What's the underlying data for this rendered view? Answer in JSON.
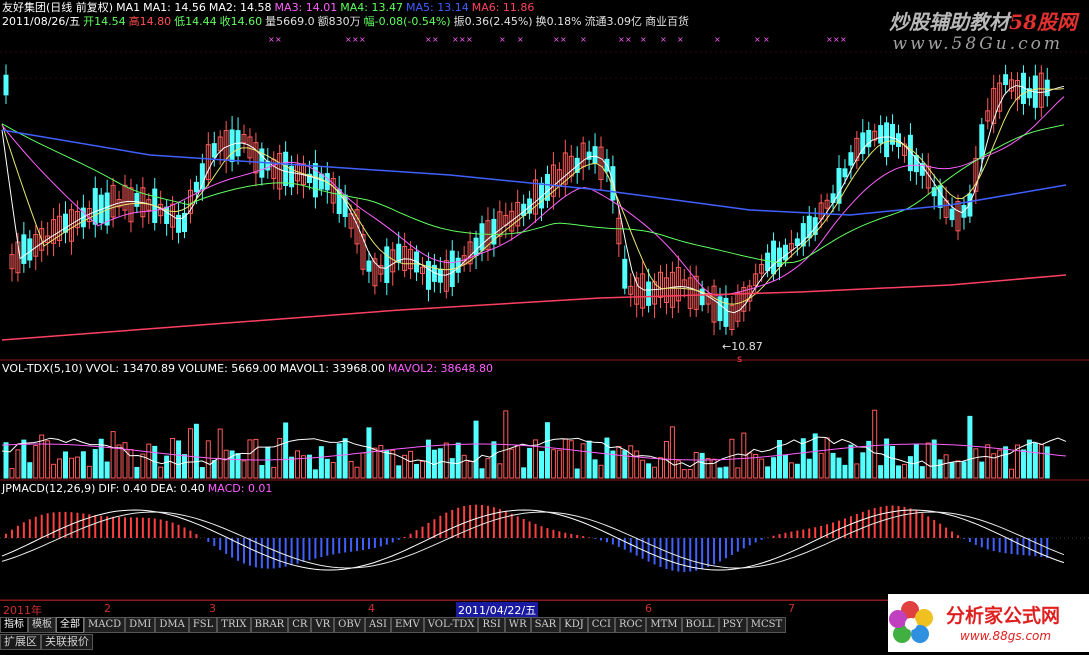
{
  "header": {
    "stock_name": "友好集团(日线 前复权)",
    "ma1_label": "MA1",
    "ma1": "MA1: 14.56",
    "ma2": "MA2: 14.58",
    "ma3": "MA3: 14.01",
    "ma4": "MA4: 13.47",
    "ma5": "MA5: 13.14",
    "ma6": "MA6: 11.86",
    "date": "2011/08/26/五",
    "open": "开14.54",
    "high": "高14.80",
    "low": "低14.44",
    "close": "收14.60",
    "volume": "量5669.0",
    "amount": "额830万",
    "change": "幅-0.08(-0.54%)",
    "amplitude": "振0.36(2.45%)",
    "turnover": "换0.18%",
    "float_cap": "流通3.09亿",
    "sector": "商业百货"
  },
  "watermark": {
    "text_main": "炒股辅助教材",
    "text_red": "58股网",
    "url": "www.58Gu.com"
  },
  "price_annotation": "←10.87",
  "vol_header": {
    "indicator": "VOL-TDX(5,10)",
    "vvol": "VVOL: 13470.89",
    "volume": "VOLUME: 5669.00",
    "mavol1": "MAVOL1: 33968.00",
    "mavol2": "MAVOL2: 38648.80"
  },
  "macd_header": {
    "indicator": "JPMACD(12,26,9)",
    "dif": "DIF: 0.40",
    "dea": "DEA: 0.40",
    "macd": "MACD: 0.01"
  },
  "date_axis": {
    "labels": [
      "2011年",
      "2",
      "3",
      "4",
      "6",
      "7"
    ],
    "cursor_date": "2011/04/22/五"
  },
  "indicator_tabs": [
    "指标",
    "模板",
    "全部",
    "MACD",
    "DMI",
    "DMA",
    "FSL",
    "TRIX",
    "BRAR",
    "CR",
    "VR",
    "OBV",
    "ASI",
    "EMV",
    "VOL-TDX",
    "RSI",
    "WR",
    "SAR",
    "KDJ",
    "CCI",
    "ROC",
    "MTM",
    "BOLL",
    "PSY",
    "MCST"
  ],
  "bottom_tabs": [
    "扩展区",
    "关联报价"
  ],
  "logo": {
    "name": "分析家公式网",
    "url": "www.88gs.com"
  },
  "colors": {
    "up": "#ff5a5a",
    "down": "#54ffff",
    "ma1": "#ffffff",
    "ma2": "#e8e870",
    "ma3": "#ff60ff",
    "ma4": "#60ff60",
    "ma5": "#4060ff",
    "ma6": "#ff4060",
    "grid": "#8a1a1a"
  }
}
